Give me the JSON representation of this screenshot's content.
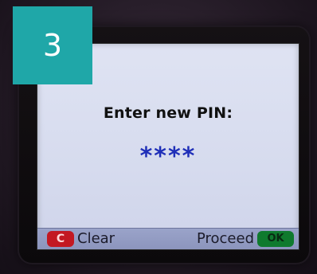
{
  "step": {
    "number": "3"
  },
  "screen": {
    "prompt": "Enter new PIN:",
    "pin_mask": "****"
  },
  "softkeys": {
    "left_key": "C",
    "left_label": "Clear",
    "right_label": "Proceed",
    "right_key": "OK"
  },
  "colors": {
    "badge": "#1fa7a8",
    "pin_text": "#1f2fb8",
    "clear_key": "#c31822",
    "ok_key": "#0f7a2e",
    "screen_bg": "#d6dbee"
  }
}
